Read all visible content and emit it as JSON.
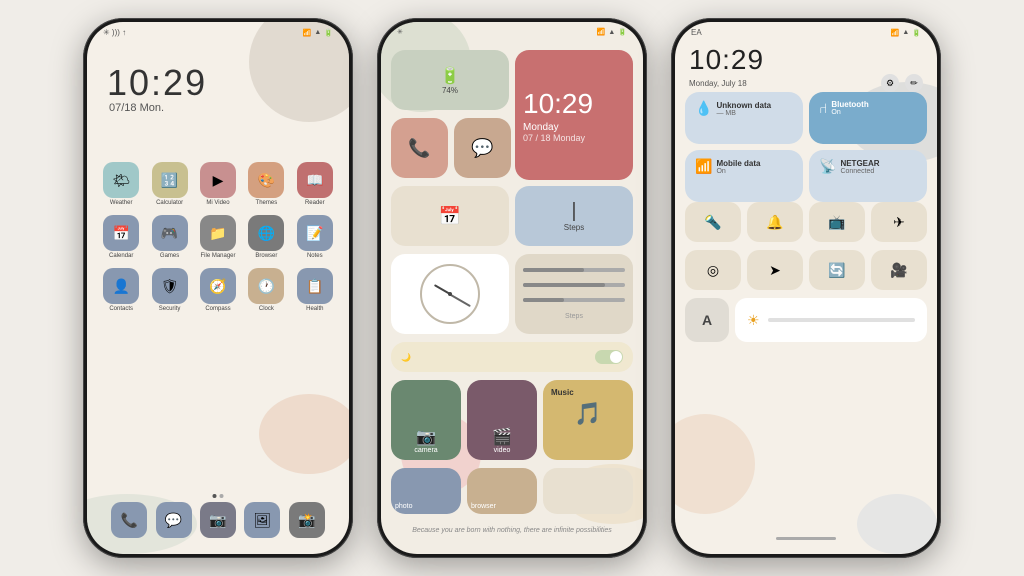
{
  "page": {
    "background": "#f0ede8"
  },
  "phone1": {
    "status_time": "10:29",
    "status_date": "07/18  Mon.",
    "apps": [
      {
        "label": "Weather",
        "icon": "🌤",
        "color": "#a0c8c8"
      },
      {
        "label": "Calculator",
        "icon": "🔢",
        "color": "#c8c090"
      },
      {
        "label": "Mi Video",
        "icon": "▶",
        "color": "#c89090"
      },
      {
        "label": "Themes",
        "icon": "🎨",
        "color": "#d4a080"
      },
      {
        "label": "Reader",
        "icon": "📖",
        "color": "#c07070"
      },
      {
        "label": "Calendar",
        "icon": "📅",
        "color": "#8898b0"
      },
      {
        "label": "Games",
        "icon": "🎮",
        "color": "#8898b0"
      },
      {
        "label": "File\nManager",
        "icon": "📁",
        "color": "#888888"
      },
      {
        "label": "Browser",
        "icon": "🌐",
        "color": "#7a7a7a"
      },
      {
        "label": "Notes",
        "icon": "📝",
        "color": "#8898b0"
      },
      {
        "label": "Contacts",
        "icon": "👤",
        "color": "#8898b0"
      },
      {
        "label": "Security",
        "icon": "🛡",
        "color": "#8898b0"
      },
      {
        "label": "Compass",
        "icon": "🧭",
        "color": "#8898b0"
      },
      {
        "label": "Clock",
        "icon": "🕐",
        "color": "#c8b090"
      },
      {
        "label": "Health",
        "icon": "📋",
        "color": "#8898b0"
      }
    ],
    "dock": [
      {
        "icon": "📞",
        "color": "#8898b0"
      },
      {
        "icon": "💬",
        "color": "#8898b0"
      },
      {
        "icon": "📷",
        "color": "#7a7a88"
      },
      {
        "icon": "🖼",
        "color": "#8898b0"
      },
      {
        "icon": "📸",
        "color": "#7a7a7a"
      }
    ]
  },
  "phone2": {
    "time": "10:29",
    "day": "Monday",
    "date": "07 / 18  Monday",
    "battery_label": "Battery",
    "battery_pct": "74%",
    "steps_label": "Steps",
    "quote": "Because you are born with nothing, there are infinite possibilities"
  },
  "phone3": {
    "ea_label": "EA",
    "time": "10:29",
    "date": "Monday, July 18",
    "unknown_data_label": "Unknown data",
    "unknown_data_sub": "— MB",
    "bluetooth_label": "Bluetooth",
    "bluetooth_sub": "On",
    "mobile_label": "Mobile data",
    "mobile_sub": "On",
    "wifi_label": "NETGEAR",
    "wifi_sub": "Connected",
    "nav_hint": "Home indicator"
  }
}
